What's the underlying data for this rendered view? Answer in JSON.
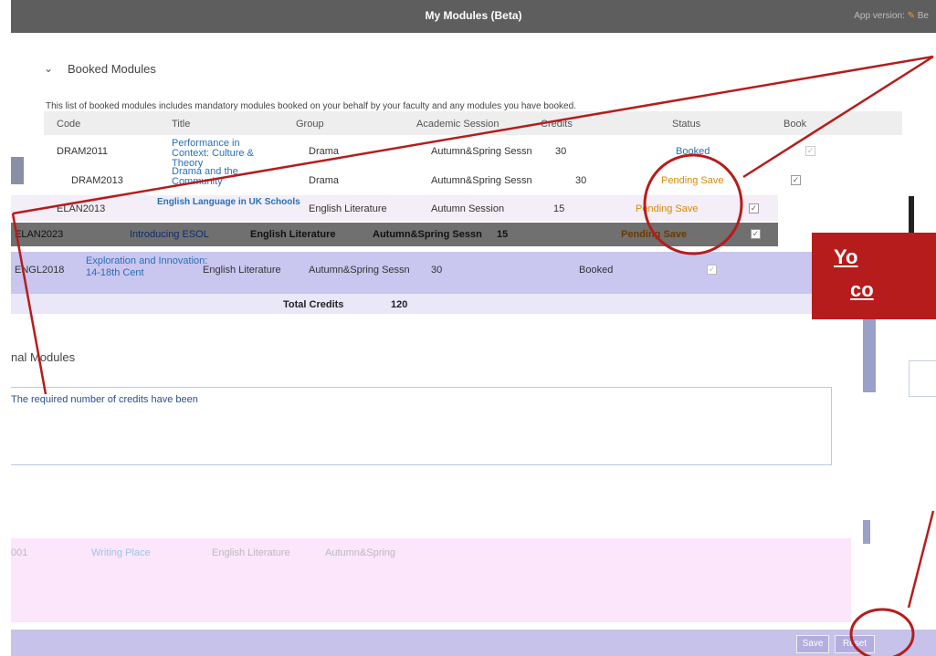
{
  "header": {
    "title": "My Modules (Beta)",
    "version_label": "App version:",
    "version_suffix": "Be"
  },
  "booked": {
    "section_title": "Booked Modules",
    "intro": "This list of booked modules includes mandatory modules booked on your behalf by your faculty and any modules you have booked.",
    "columns": [
      "Code",
      "Title",
      "Group",
      "Academic Session",
      "Credits",
      "Status",
      "Book"
    ],
    "rows": [
      {
        "code": "DRAM2011",
        "title": "Performance in Context: Culture & Theory",
        "group": "Drama",
        "session": "Autumn&Spring Sessn",
        "credits": "30",
        "status": "Booked"
      },
      {
        "code": "DRAM2013",
        "title": "Drama and the Community",
        "group": "Drama",
        "session": "Autumn&Spring Sessn",
        "credits": "30",
        "status": "Pending Save"
      },
      {
        "code": "ELAN2013",
        "title": "English Language in UK Schools",
        "group": "English Literature",
        "session": "Autumn Session",
        "credits": "15",
        "status": "Pending Save"
      },
      {
        "code": "ELAN2023",
        "title": "Introducing ESOL",
        "group": "English Literature",
        "session": "Autumn&Spring Sessn",
        "credits": "15",
        "status": "Pending Save"
      },
      {
        "code": "ENGL2018",
        "title": "Exploration and Innovation: 14-18th Cent",
        "group": "English Literature",
        "session": "Autumn&Spring Sessn",
        "credits": "30",
        "status": "Booked"
      }
    ],
    "total_label": "Total Credits",
    "total_value": "120"
  },
  "optional": {
    "section_title": "Optional Modules",
    "section_title_visible": "nal Modules",
    "notice": "The required number of credits have been"
  },
  "optional_row": {
    "code": "001",
    "title": "Writing Place",
    "group": "English Literature",
    "session": "Autumn&Spring"
  },
  "banner": {
    "line1": "Yo",
    "line2": "co"
  },
  "buttons": {
    "save": "Save",
    "reset": "Reset"
  },
  "colors": {
    "annotation": "#b71c1c",
    "pending": "#d98a00",
    "link": "#2870b8"
  }
}
